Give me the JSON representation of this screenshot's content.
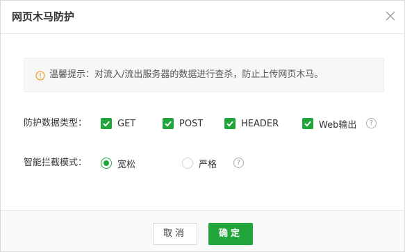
{
  "dialog": {
    "title": "网页木马防护",
    "close_icon": "close-icon"
  },
  "tip": {
    "icon": "info-circle-icon",
    "text": "温馨提示：对流入/流出服务器的数据进行查杀，防止上传网页木马。"
  },
  "protect_types": {
    "label": "防护数据类型：",
    "options": [
      {
        "label": "GET",
        "checked": true
      },
      {
        "label": "POST",
        "checked": true
      },
      {
        "label": "HEADER",
        "checked": true
      },
      {
        "label": "Web输出",
        "checked": true
      }
    ],
    "help": "?"
  },
  "intercept_mode": {
    "label": "智能拦截模式：",
    "options": [
      {
        "label": "宽松",
        "selected": true
      },
      {
        "label": "严格",
        "selected": false
      }
    ],
    "help": "?"
  },
  "footer": {
    "cancel_label": "取消",
    "ok_label": "确定"
  },
  "colors": {
    "accent": "#20a53a",
    "tip_icon": "#f0a030",
    "tip_bg": "#f7f7f7"
  }
}
